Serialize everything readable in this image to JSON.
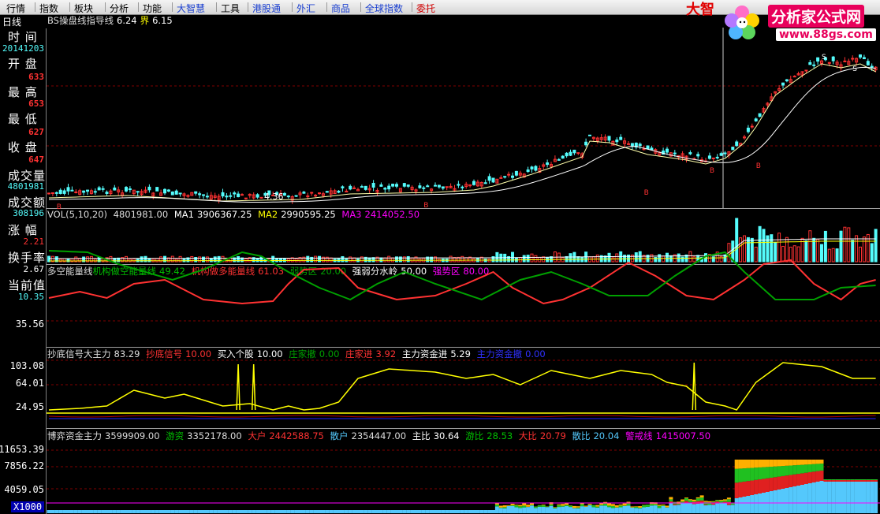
{
  "menubar": [
    {
      "label": "行情",
      "color": "normal"
    },
    {
      "label": "指数",
      "color": "normal"
    },
    {
      "label": "板块",
      "color": "normal"
    },
    {
      "label": "分析",
      "color": "normal"
    },
    {
      "label": "功能",
      "color": "normal"
    },
    {
      "label": "大智慧",
      "color": "blue"
    },
    {
      "label": "工具",
      "color": "normal"
    },
    {
      "label": "港股通",
      "color": "blue"
    },
    {
      "label": "外汇",
      "color": "blue"
    },
    {
      "label": "商品",
      "color": "blue"
    },
    {
      "label": "全球指数",
      "color": "blue"
    },
    {
      "label": "委托",
      "color": "red"
    }
  ],
  "brand": {
    "dazhi": "大智",
    "site_name": "分析家公式网",
    "url": "www.88gs.com"
  },
  "period_tab": "日线",
  "info_panel": {
    "time_label": "时  间",
    "time_value": "20141203",
    "open_label": "开  盘",
    "open_value": "633",
    "high_label": "最  高",
    "high_value": "653",
    "low_label": "最  低",
    "low_value": "627",
    "close_label": "收  盘",
    "close_value": "647",
    "vol_label": "成交量",
    "vol_value": "4801981",
    "amount_label": "成交额",
    "amount_value": "308196",
    "change_label": "涨  幅",
    "change_value": "2.21",
    "turnover_label": "换手率",
    "turnover_value": "2.67",
    "current_label": "当前值",
    "current_value": "10.35"
  },
  "price_panel": {
    "title": "BS操盘线指导线",
    "val1": "6.24",
    "label2": "界",
    "val2": "6.15",
    "low_annotation": "4.36",
    "signal_labels": [
      "B",
      "S"
    ]
  },
  "vol_panel": {
    "name": "VOL(5,10,20)",
    "vol": "4801981.00",
    "ma1_label": "MA1",
    "ma1": "3906367.25",
    "ma2_label": "MA2",
    "ma2": "2990595.25",
    "ma3_label": "MA3",
    "ma3": "2414052.50"
  },
  "energy_panel": {
    "name": "多空能量线",
    "a_label": "机构做空能量线",
    "a_val": "49.42",
    "b_label": "机构做多能量线",
    "b_val": "61.03",
    "c_label": "弱势区",
    "c_val": "20.00",
    "d_label": "强弱分水岭",
    "d_val": "50.00",
    "e_label": "强势区",
    "e_val": "80.00",
    "axis": "35.56"
  },
  "signal_panel": {
    "name": "抄底信号大主力",
    "name_val": "83.29",
    "a_label": "抄底信号",
    "a_val": "10.00",
    "b_label": "买入个股",
    "b_val": "10.00",
    "c_label": "庄家撤",
    "c_val": "0.00",
    "d_label": "庄家进",
    "d_val": "3.92",
    "e_label": "主力资金进",
    "e_val": "5.29",
    "f_label": "主力资金撤",
    "f_val": "0.00",
    "axis": [
      "103.08",
      "64.01",
      "24.95"
    ]
  },
  "game_panel": {
    "name": "博弈资金主力",
    "name_val": "3599909.00",
    "a_label": "游资",
    "a_val": "3352178.00",
    "b_label": "大户",
    "b_val": "2442588.75",
    "c_label": "散户",
    "c_val": "2354447.00",
    "d_label": "主比",
    "d_val": "30.64",
    "e_label": "游比",
    "e_val": "28.53",
    "f_label": "大比",
    "f_val": "20.79",
    "g_label": "散比",
    "g_val": "20.04",
    "h_label": "警戒线",
    "h_val": "1415007.50",
    "axis": [
      "11653.39",
      "7856.22",
      "4059.05"
    ],
    "zoom": "X1000"
  },
  "colors": {
    "up": "#ff3232",
    "down": "#54fcfc",
    "yellow": "#ffff00",
    "green": "#00a000",
    "magenta": "#ff00ff",
    "white": "#ffffff",
    "dark_red": "#b00000",
    "sky": "#54c8fc",
    "orange": "#ffb000",
    "blue": "#2020ff"
  }
}
